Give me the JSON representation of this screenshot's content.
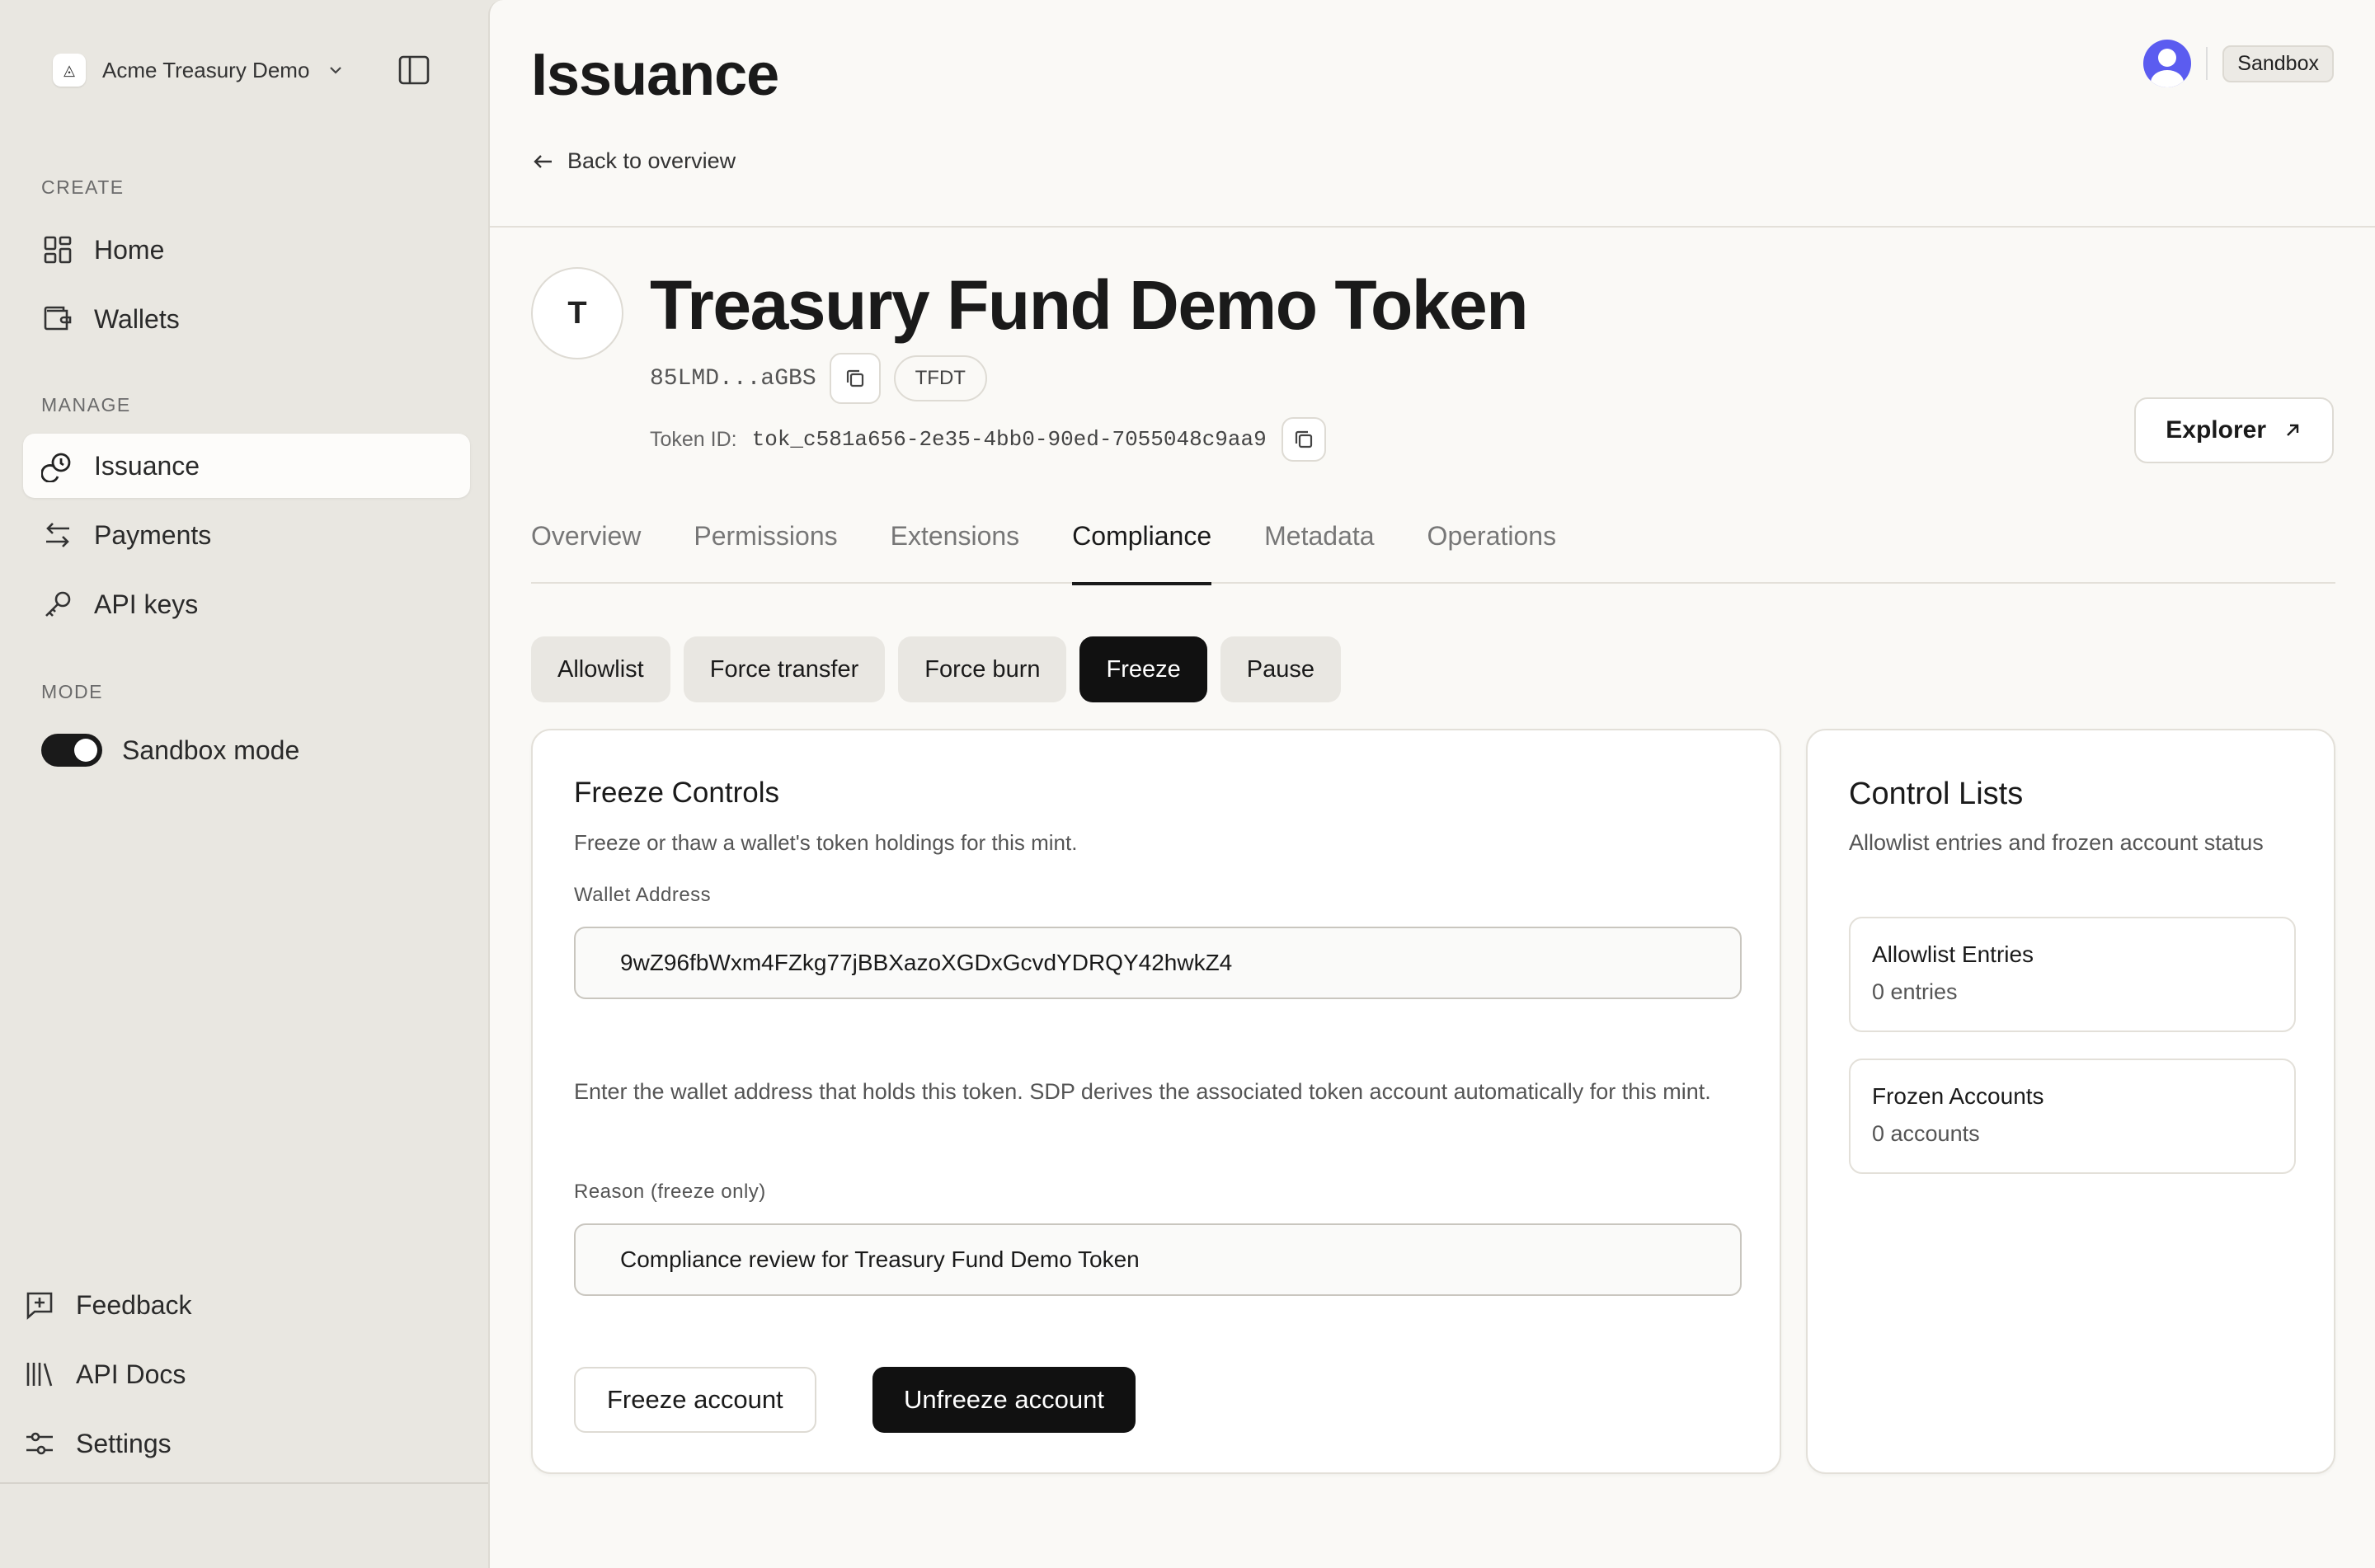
{
  "workspace": {
    "logo_glyph": "◬",
    "name": "Acme Treasury Demo"
  },
  "sidebar": {
    "sections": {
      "create": "CREATE",
      "manage": "MANAGE",
      "mode": "MODE"
    },
    "items": [
      {
        "label": "Home",
        "icon": "grid-icon"
      },
      {
        "label": "Wallets",
        "icon": "wallet-icon"
      },
      {
        "label": "Issuance",
        "icon": "coins-icon",
        "active": true
      },
      {
        "label": "Payments",
        "icon": "arrows-icon"
      },
      {
        "label": "API keys",
        "icon": "key-icon"
      }
    ],
    "toggle_label": "Sandbox mode",
    "footer": [
      {
        "label": "Feedback",
        "icon": "feedback-icon"
      },
      {
        "label": "API Docs",
        "icon": "library-icon"
      },
      {
        "label": "Settings",
        "icon": "sliders-icon"
      }
    ]
  },
  "header": {
    "title": "Issuance",
    "back_label": "Back to overview",
    "env_badge": "Sandbox"
  },
  "token": {
    "avatar_letter": "T",
    "name": "Treasury Fund Demo Token",
    "address_short": "85LMD...aGBS",
    "symbol": "TFDT",
    "id_label": "Token ID:",
    "id_value": "tok_c581a656-2e35-4bb0-90ed-7055048c9aa9",
    "explorer_label": "Explorer"
  },
  "tabs": [
    "Overview",
    "Permissions",
    "Extensions",
    "Compliance",
    "Metadata",
    "Operations"
  ],
  "active_tab": "Compliance",
  "subtabs": [
    "Allowlist",
    "Force transfer",
    "Force burn",
    "Freeze",
    "Pause"
  ],
  "active_subtab": "Freeze",
  "freeze_card": {
    "title": "Freeze Controls",
    "subtitle": "Freeze or thaw a wallet's token holdings for this mint.",
    "wallet_label": "Wallet Address",
    "wallet_value": "9wZ96fbWxm4FZkg77jBBXazoXGDxGcvdYDRQY42hwkZ4",
    "help": "Enter the wallet address that holds this token. SDP derives the associated token account automatically for this mint.",
    "reason_label": "Reason (freeze only)",
    "reason_value": "Compliance review for Treasury Fund Demo Token",
    "freeze_btn": "Freeze account",
    "unfreeze_btn": "Unfreeze account"
  },
  "lists_card": {
    "title": "Control Lists",
    "subtitle": "Allowlist entries and frozen account status",
    "allowlist_title": "Allowlist Entries",
    "allowlist_value": "0 entries",
    "frozen_title": "Frozen Accounts",
    "frozen_value": "0 accounts"
  },
  "colors": {
    "accent": "#111111",
    "avatar": "#5b5cf0",
    "sidebar_bg": "#e9e7e1"
  }
}
